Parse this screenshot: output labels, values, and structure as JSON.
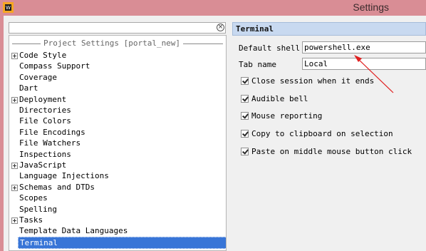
{
  "window": {
    "title": "Settings"
  },
  "search": {
    "value": ""
  },
  "tree": {
    "group_title": "Project Settings [portal_new]",
    "items": [
      {
        "label": "Code Style",
        "expandable": true
      },
      {
        "label": "Compass Support",
        "expandable": false
      },
      {
        "label": "Coverage",
        "expandable": false
      },
      {
        "label": "Dart",
        "expandable": false
      },
      {
        "label": "Deployment",
        "expandable": true
      },
      {
        "label": "Directories",
        "expandable": false
      },
      {
        "label": "File Colors",
        "expandable": false
      },
      {
        "label": "File Encodings",
        "expandable": false
      },
      {
        "label": "File Watchers",
        "expandable": false
      },
      {
        "label": "Inspections",
        "expandable": false
      },
      {
        "label": "JavaScript",
        "expandable": true
      },
      {
        "label": "Language Injections",
        "expandable": false
      },
      {
        "label": "Schemas and DTDs",
        "expandable": true
      },
      {
        "label": "Scopes",
        "expandable": false
      },
      {
        "label": "Spelling",
        "expandable": false
      },
      {
        "label": "Tasks",
        "expandable": true
      },
      {
        "label": "Template Data Languages",
        "expandable": false
      },
      {
        "label": "Terminal",
        "expandable": false,
        "selected": true
      }
    ]
  },
  "panel": {
    "title": "Terminal",
    "default_shell_label": "Default shell",
    "default_shell_value": "powershell.exe",
    "tab_name_label": "Tab name",
    "tab_name_value": "Local",
    "checkboxes": [
      {
        "label": "Close session when it ends",
        "checked": true
      },
      {
        "label": "Audible bell",
        "checked": true
      },
      {
        "label": "Mouse reporting",
        "checked": true
      },
      {
        "label": "Copy to clipboard on selection",
        "checked": true
      },
      {
        "label": "Paste on middle mouse button click",
        "checked": true
      }
    ]
  },
  "colors": {
    "titlebar": "#d98d95",
    "selection": "#3875d7",
    "panel_header": "#c8d9f0",
    "annotation_arrow": "#e02020"
  },
  "icons": {
    "app": "webstorm-app-icon",
    "clear": "clear-search-icon",
    "expand": "tree-expand-plus-icon",
    "check": "checkbox-check-icon",
    "annotation": "red-annotation-arrow"
  }
}
